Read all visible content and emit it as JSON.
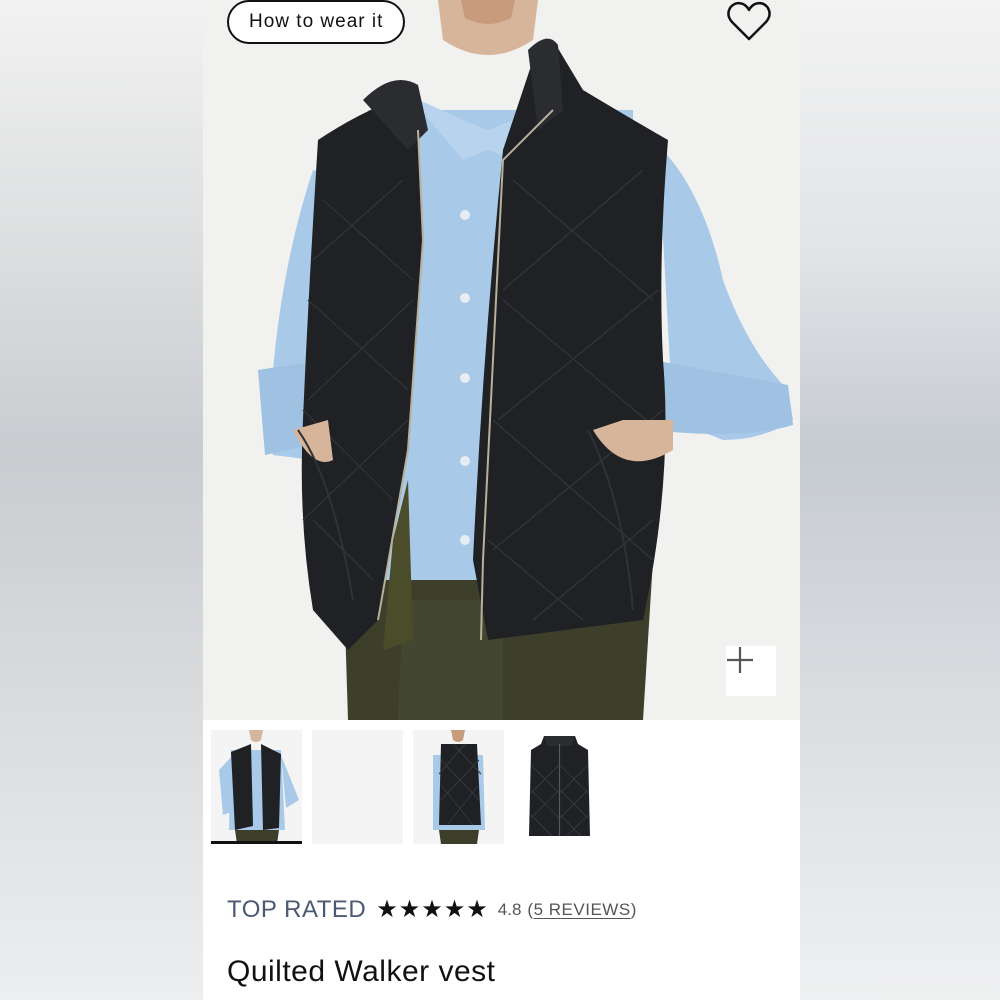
{
  "hero": {
    "how_to_wear_label": "How to wear it"
  },
  "icons": {
    "wishlist": "heart-icon",
    "zoom": "plus-icon",
    "star": "star-icon"
  },
  "thumbnails": [
    {
      "name": "model-front",
      "active": true
    },
    {
      "name": "blank",
      "active": false
    },
    {
      "name": "model-back",
      "active": false
    },
    {
      "name": "product-flat",
      "active": false
    }
  ],
  "product": {
    "badge": "TOP RATED",
    "rating_stars": 5,
    "rating_value": "4.8",
    "reviews_open": "(",
    "reviews_label": "5 REVIEWS",
    "reviews_close": ")",
    "title": "Quilted Walker vest"
  },
  "colors": {
    "vest": "#1f2124",
    "shirt": "#a9c9e8",
    "pants": "#3d3f2a",
    "badge_text": "#4b5a72"
  }
}
